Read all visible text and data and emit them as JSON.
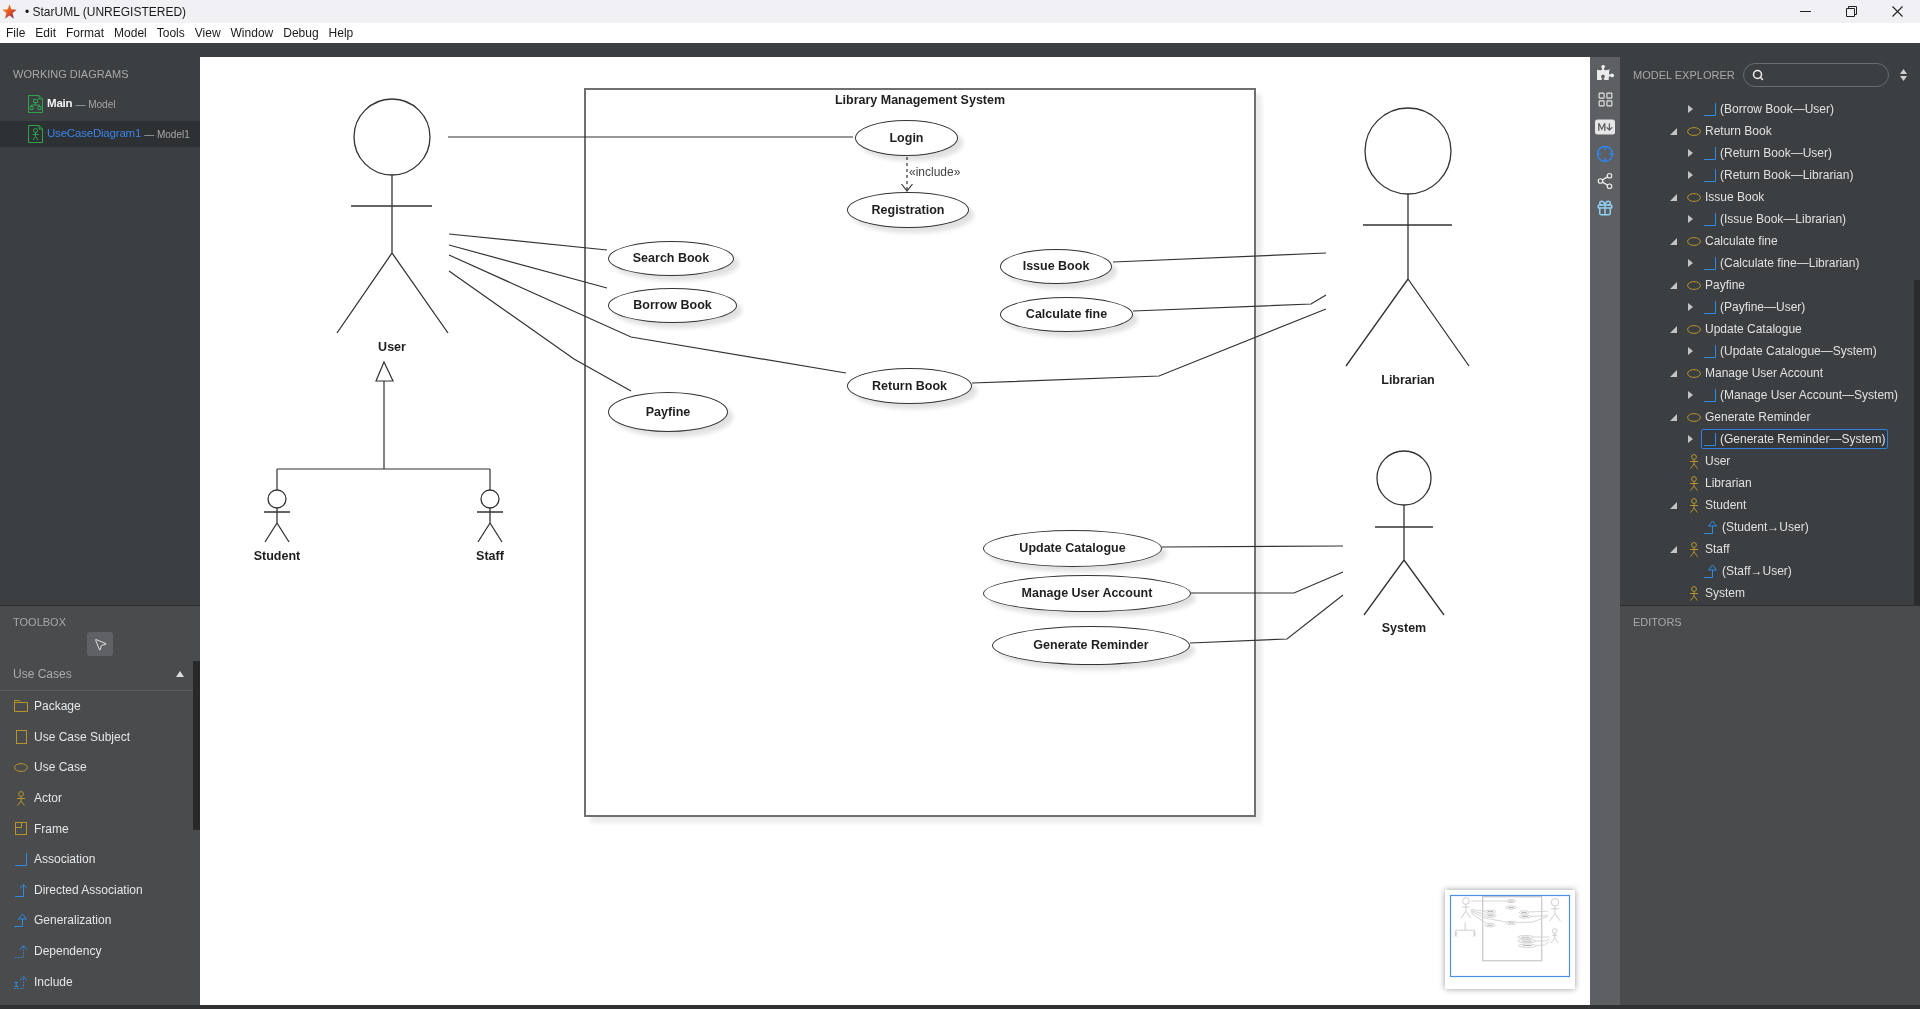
{
  "window": {
    "title": "• StarUML (UNREGISTERED)"
  },
  "menu": [
    "File",
    "Edit",
    "Format",
    "Model",
    "Tools",
    "View",
    "Window",
    "Debug",
    "Help"
  ],
  "working_diagrams": {
    "title": "WORKING DIAGRAMS",
    "items": [
      {
        "kind": "class_diagram",
        "name": "Main",
        "owner": "— Model",
        "selected": false
      },
      {
        "kind": "use_case_diagram",
        "name": "UseCaseDiagram1",
        "owner": "— Model1",
        "selected": true
      }
    ]
  },
  "toolbox": {
    "title": "TOOLBOX",
    "pointer_tool": {
      "selected": true
    },
    "group": {
      "label": "Use Cases",
      "expanded": true,
      "items": [
        {
          "kind": "package",
          "label": "Package"
        },
        {
          "kind": "use_case_subject",
          "label": "Use Case Subject"
        },
        {
          "kind": "use_case",
          "label": "Use Case"
        },
        {
          "kind": "actor",
          "label": "Actor"
        },
        {
          "kind": "frame",
          "label": "Frame"
        },
        {
          "kind": "association",
          "label": "Association"
        },
        {
          "kind": "directed_association",
          "label": "Directed Association"
        },
        {
          "kind": "generalization",
          "label": "Generalization"
        },
        {
          "kind": "dependency",
          "label": "Dependency"
        },
        {
          "kind": "include",
          "label": "Include"
        }
      ]
    }
  },
  "diagram": {
    "subject": {
      "title": "Library Management System"
    },
    "actors": [
      "User",
      "Student",
      "Staff",
      "Librarian",
      "System"
    ],
    "use_cases": [
      "Login",
      "Registration",
      "Search Book",
      "Borrow Book",
      "Issue Book",
      "Calculate fine",
      "Return Book",
      "Payfine",
      "Update Catalogue",
      "Manage User Account",
      "Generate Reminder"
    ],
    "include_label": "«include»"
  },
  "model_explorer": {
    "title": "MODEL EXPLORER",
    "continued_children": [
      {
        "kind": "association",
        "label": "(Borrow Book—User)",
        "expanded": false,
        "selected": false
      }
    ],
    "items": [
      {
        "kind": "use_case",
        "label": "Return Book",
        "expanded": true,
        "selected": false,
        "children": [
          {
            "kind": "association",
            "label": "(Return Book—User)",
            "expanded": false,
            "selected": false
          },
          {
            "kind": "association",
            "label": "(Return Book—Librarian)",
            "expanded": false,
            "selected": false
          }
        ]
      },
      {
        "kind": "use_case",
        "label": "Issue Book",
        "expanded": true,
        "selected": false,
        "children": [
          {
            "kind": "association",
            "label": "(Issue Book—Librarian)",
            "expanded": false,
            "selected": false
          }
        ]
      },
      {
        "kind": "use_case",
        "label": "Calculate fine",
        "expanded": true,
        "selected": false,
        "children": [
          {
            "kind": "association",
            "label": "(Calculate fine—Librarian)",
            "expanded": false,
            "selected": false
          }
        ]
      },
      {
        "kind": "use_case",
        "label": "Payfine",
        "expanded": true,
        "selected": false,
        "children": [
          {
            "kind": "association",
            "label": "(Payfine—User)",
            "expanded": false,
            "selected": false
          }
        ]
      },
      {
        "kind": "use_case",
        "label": "Update Catalogue",
        "expanded": true,
        "selected": false,
        "children": [
          {
            "kind": "association",
            "label": "(Update Catalogue—System)",
            "expanded": false,
            "selected": false
          }
        ]
      },
      {
        "kind": "use_case",
        "label": "Manage User Account",
        "expanded": true,
        "selected": false,
        "children": [
          {
            "kind": "association",
            "label": "(Manage User Account—System)",
            "expanded": false,
            "selected": false
          }
        ]
      },
      {
        "kind": "use_case",
        "label": "Generate Reminder",
        "expanded": true,
        "selected": false,
        "children": [
          {
            "kind": "association",
            "label": "(Generate Reminder—System)",
            "expanded": false,
            "selected": true
          }
        ]
      },
      {
        "kind": "actor",
        "label": "User",
        "selected": false
      },
      {
        "kind": "actor",
        "label": "Librarian",
        "selected": false
      },
      {
        "kind": "actor",
        "label": "Student",
        "expanded": true,
        "selected": false,
        "children": [
          {
            "kind": "generalization",
            "label": "(Student→User)",
            "selected": false
          }
        ]
      },
      {
        "kind": "actor",
        "label": "Staff",
        "expanded": true,
        "selected": false,
        "children": [
          {
            "kind": "generalization",
            "label": "(Staff→User)",
            "selected": false
          }
        ]
      },
      {
        "kind": "actor",
        "label": "System",
        "selected": false
      }
    ]
  },
  "editors": {
    "title": "EDITORS"
  }
}
